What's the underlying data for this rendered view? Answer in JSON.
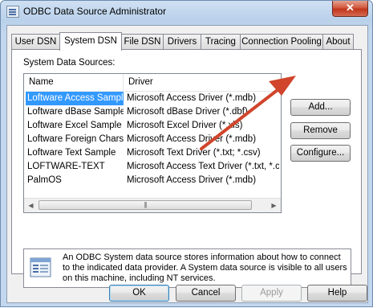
{
  "window": {
    "title": "ODBC Data Source Administrator",
    "close_label": "✕"
  },
  "tabs": [
    "User DSN",
    "System DSN",
    "File DSN",
    "Drivers",
    "Tracing",
    "Connection Pooling",
    "About"
  ],
  "active_tab": "System DSN",
  "panel": {
    "section_label": "System Data Sources:",
    "columns": {
      "name": "Name",
      "driver": "Driver"
    },
    "rows": [
      {
        "name": "Loftware Access Sample",
        "driver": "Microsoft Access Driver (*.mdb)"
      },
      {
        "name": "Loftware dBase Sample",
        "driver": "Microsoft dBase Driver (*.dbf)"
      },
      {
        "name": "Loftware Excel Sample",
        "driver": "Microsoft Excel Driver (*.xls)"
      },
      {
        "name": "Loftware Foreign Charset",
        "driver": "Microsoft Access Driver (*.mdb)"
      },
      {
        "name": "Loftware Text Sample",
        "driver": "Microsoft Text Driver (*.txt; *.csv)"
      },
      {
        "name": "LOFTWARE-TEXT",
        "driver": "Microsoft Access Text Driver (*.txt, *.c"
      },
      {
        "name": "PalmOS",
        "driver": "Microsoft Access Driver (*.mdb)"
      }
    ],
    "selected_row": "Loftware Access Sample",
    "buttons": {
      "add": "Add...",
      "remove": "Remove",
      "configure": "Configure..."
    },
    "info_text": "An ODBC System data source stores information about how to connect to the indicated data provider.   A System data source is visible to all users on this machine, including NT services."
  },
  "footer": {
    "ok": "OK",
    "cancel": "Cancel",
    "apply": "Apply",
    "help": "Help"
  },
  "colors": {
    "selection": "#3399ff",
    "annotation_arrow": "#d0452c"
  },
  "icons": {
    "scroll_left": "◀",
    "scroll_right": "▶",
    "thumb_grip": "|||"
  }
}
